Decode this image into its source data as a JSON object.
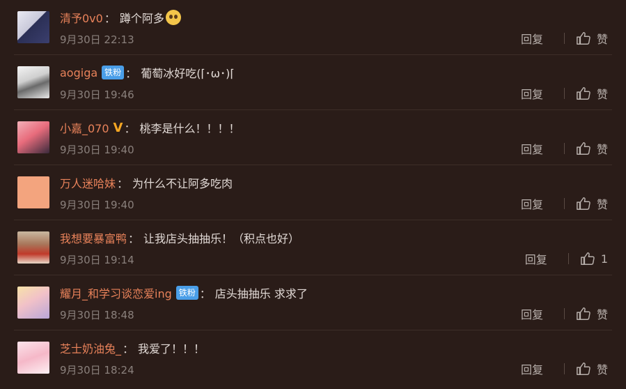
{
  "comments": [
    {
      "username": "清予0v0",
      "badge": "",
      "vip": false,
      "text": "蹲个阿多",
      "emoji": true,
      "time": "9月30日 22:13",
      "reply": "回复",
      "like": "赞"
    },
    {
      "username": "aogiga",
      "badge": "铁粉",
      "vip": false,
      "text": "葡萄冰好吃(⌈･ω･)⌈",
      "emoji": false,
      "time": "9月30日 19:46",
      "reply": "回复",
      "like": "赞"
    },
    {
      "username": "小嘉_070",
      "badge": "",
      "vip": true,
      "text": "桃李是什么！！！！",
      "emoji": false,
      "time": "9月30日 19:40",
      "reply": "回复",
      "like": "赞"
    },
    {
      "username": "万人迷哈妹",
      "badge": "",
      "vip": false,
      "text": "为什么不让阿多吃肉",
      "emoji": false,
      "time": "9月30日 19:40",
      "reply": "回复",
      "like": "赞"
    },
    {
      "username": "我想要暴富鸭",
      "badge": "",
      "vip": false,
      "text": "让我店头抽抽乐！（积点也好）",
      "emoji": false,
      "time": "9月30日 19:14",
      "reply": "回复",
      "like": "1"
    },
    {
      "username": "耀月_和学习谈恋爱ing",
      "badge": "铁粉",
      "vip": false,
      "text": "店头抽抽乐 求求了",
      "emoji": false,
      "time": "9月30日 18:48",
      "reply": "回复",
      "like": "赞"
    },
    {
      "username": "芝士奶油兔_",
      "badge": "",
      "vip": false,
      "text": "我爱了！！！",
      "emoji": false,
      "time": "9月30日 18:24",
      "reply": "回复",
      "like": "赞"
    }
  ],
  "vip_symbol": "V",
  "colon": "：",
  "colors": {
    "username": "#e8825a",
    "badge": "#4a9ee8",
    "vip": "#f5a623",
    "background": "#2a1c18"
  }
}
